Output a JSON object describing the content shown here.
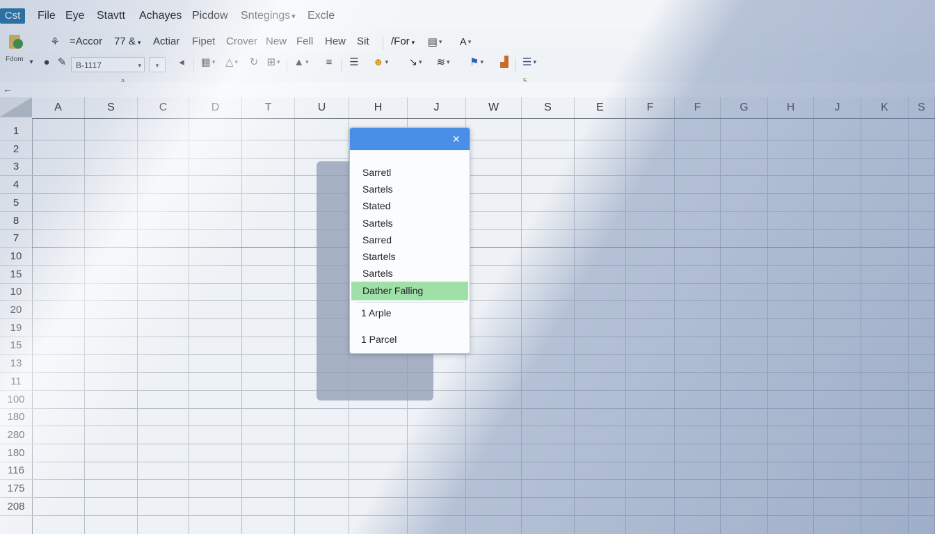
{
  "app": {
    "badge": "Cst"
  },
  "menu": [
    {
      "label": "File",
      "caret": false
    },
    {
      "label": "Eye",
      "caret": false
    },
    {
      "label": "Stavtt",
      "caret": false
    },
    {
      "label": "Achayes",
      "caret": false
    },
    {
      "label": "Picdow",
      "caret": false
    },
    {
      "label": "Sntegings",
      "caret": true
    },
    {
      "label": "Excle",
      "caret": false
    }
  ],
  "toolbar1": {
    "items": [
      "=Accor",
      "77 &",
      "Actiar",
      "Fipet",
      "Crover",
      "New",
      "Fell",
      "Hew",
      "Sit",
      "/For"
    ],
    "small_label": "Fdom"
  },
  "toolbar2": {
    "name_box": "B-1117",
    "hint_a": "a",
    "hint_s": "5"
  },
  "columns": [
    "A",
    "S",
    "C",
    "D",
    "T",
    "U",
    "H",
    "J",
    "W",
    "S",
    "E",
    "F",
    "F",
    "G",
    "H",
    "J",
    "K",
    "S"
  ],
  "rows": [
    "1",
    "2",
    "3",
    "4",
    "5",
    "8",
    "7",
    "10",
    "15",
    "10",
    "20",
    "19",
    "15",
    "13",
    "11",
    "100",
    "180",
    "280",
    "180",
    "116",
    "175",
    "208"
  ],
  "popup": {
    "close": "×",
    "items": [
      "Sarretl",
      "Sartels",
      "Stated",
      "Sartels",
      "Sarred",
      "Startels",
      "Sartels",
      "Dather Falling"
    ],
    "selected_index": 7,
    "extra": [
      "1 Arple",
      "1 Parcel"
    ]
  },
  "icons": {
    "file": "file-icon",
    "user": "user-icon",
    "pen": "pen-icon",
    "back": "back-arrow-icon"
  }
}
